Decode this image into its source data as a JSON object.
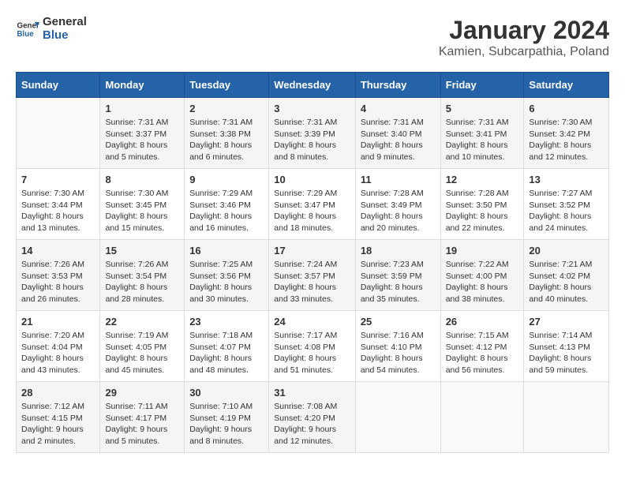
{
  "logo": {
    "line1": "General",
    "line2": "Blue"
  },
  "title": "January 2024",
  "location": "Kamien, Subcarpathia, Poland",
  "weekdays": [
    "Sunday",
    "Monday",
    "Tuesday",
    "Wednesday",
    "Thursday",
    "Friday",
    "Saturday"
  ],
  "weeks": [
    [
      {
        "day": "",
        "info": ""
      },
      {
        "day": "1",
        "info": "Sunrise: 7:31 AM\nSunset: 3:37 PM\nDaylight: 8 hours\nand 5 minutes."
      },
      {
        "day": "2",
        "info": "Sunrise: 7:31 AM\nSunset: 3:38 PM\nDaylight: 8 hours\nand 6 minutes."
      },
      {
        "day": "3",
        "info": "Sunrise: 7:31 AM\nSunset: 3:39 PM\nDaylight: 8 hours\nand 8 minutes."
      },
      {
        "day": "4",
        "info": "Sunrise: 7:31 AM\nSunset: 3:40 PM\nDaylight: 8 hours\nand 9 minutes."
      },
      {
        "day": "5",
        "info": "Sunrise: 7:31 AM\nSunset: 3:41 PM\nDaylight: 8 hours\nand 10 minutes."
      },
      {
        "day": "6",
        "info": "Sunrise: 7:30 AM\nSunset: 3:42 PM\nDaylight: 8 hours\nand 12 minutes."
      }
    ],
    [
      {
        "day": "7",
        "info": "Sunrise: 7:30 AM\nSunset: 3:44 PM\nDaylight: 8 hours\nand 13 minutes."
      },
      {
        "day": "8",
        "info": "Sunrise: 7:30 AM\nSunset: 3:45 PM\nDaylight: 8 hours\nand 15 minutes."
      },
      {
        "day": "9",
        "info": "Sunrise: 7:29 AM\nSunset: 3:46 PM\nDaylight: 8 hours\nand 16 minutes."
      },
      {
        "day": "10",
        "info": "Sunrise: 7:29 AM\nSunset: 3:47 PM\nDaylight: 8 hours\nand 18 minutes."
      },
      {
        "day": "11",
        "info": "Sunrise: 7:28 AM\nSunset: 3:49 PM\nDaylight: 8 hours\nand 20 minutes."
      },
      {
        "day": "12",
        "info": "Sunrise: 7:28 AM\nSunset: 3:50 PM\nDaylight: 8 hours\nand 22 minutes."
      },
      {
        "day": "13",
        "info": "Sunrise: 7:27 AM\nSunset: 3:52 PM\nDaylight: 8 hours\nand 24 minutes."
      }
    ],
    [
      {
        "day": "14",
        "info": "Sunrise: 7:26 AM\nSunset: 3:53 PM\nDaylight: 8 hours\nand 26 minutes."
      },
      {
        "day": "15",
        "info": "Sunrise: 7:26 AM\nSunset: 3:54 PM\nDaylight: 8 hours\nand 28 minutes."
      },
      {
        "day": "16",
        "info": "Sunrise: 7:25 AM\nSunset: 3:56 PM\nDaylight: 8 hours\nand 30 minutes."
      },
      {
        "day": "17",
        "info": "Sunrise: 7:24 AM\nSunset: 3:57 PM\nDaylight: 8 hours\nand 33 minutes."
      },
      {
        "day": "18",
        "info": "Sunrise: 7:23 AM\nSunset: 3:59 PM\nDaylight: 8 hours\nand 35 minutes."
      },
      {
        "day": "19",
        "info": "Sunrise: 7:22 AM\nSunset: 4:00 PM\nDaylight: 8 hours\nand 38 minutes."
      },
      {
        "day": "20",
        "info": "Sunrise: 7:21 AM\nSunset: 4:02 PM\nDaylight: 8 hours\nand 40 minutes."
      }
    ],
    [
      {
        "day": "21",
        "info": "Sunrise: 7:20 AM\nSunset: 4:04 PM\nDaylight: 8 hours\nand 43 minutes."
      },
      {
        "day": "22",
        "info": "Sunrise: 7:19 AM\nSunset: 4:05 PM\nDaylight: 8 hours\nand 45 minutes."
      },
      {
        "day": "23",
        "info": "Sunrise: 7:18 AM\nSunset: 4:07 PM\nDaylight: 8 hours\nand 48 minutes."
      },
      {
        "day": "24",
        "info": "Sunrise: 7:17 AM\nSunset: 4:08 PM\nDaylight: 8 hours\nand 51 minutes."
      },
      {
        "day": "25",
        "info": "Sunrise: 7:16 AM\nSunset: 4:10 PM\nDaylight: 8 hours\nand 54 minutes."
      },
      {
        "day": "26",
        "info": "Sunrise: 7:15 AM\nSunset: 4:12 PM\nDaylight: 8 hours\nand 56 minutes."
      },
      {
        "day": "27",
        "info": "Sunrise: 7:14 AM\nSunset: 4:13 PM\nDaylight: 8 hours\nand 59 minutes."
      }
    ],
    [
      {
        "day": "28",
        "info": "Sunrise: 7:12 AM\nSunset: 4:15 PM\nDaylight: 9 hours\nand 2 minutes."
      },
      {
        "day": "29",
        "info": "Sunrise: 7:11 AM\nSunset: 4:17 PM\nDaylight: 9 hours\nand 5 minutes."
      },
      {
        "day": "30",
        "info": "Sunrise: 7:10 AM\nSunset: 4:19 PM\nDaylight: 9 hours\nand 8 minutes."
      },
      {
        "day": "31",
        "info": "Sunrise: 7:08 AM\nSunset: 4:20 PM\nDaylight: 9 hours\nand 12 minutes."
      },
      {
        "day": "",
        "info": ""
      },
      {
        "day": "",
        "info": ""
      },
      {
        "day": "",
        "info": ""
      }
    ]
  ]
}
